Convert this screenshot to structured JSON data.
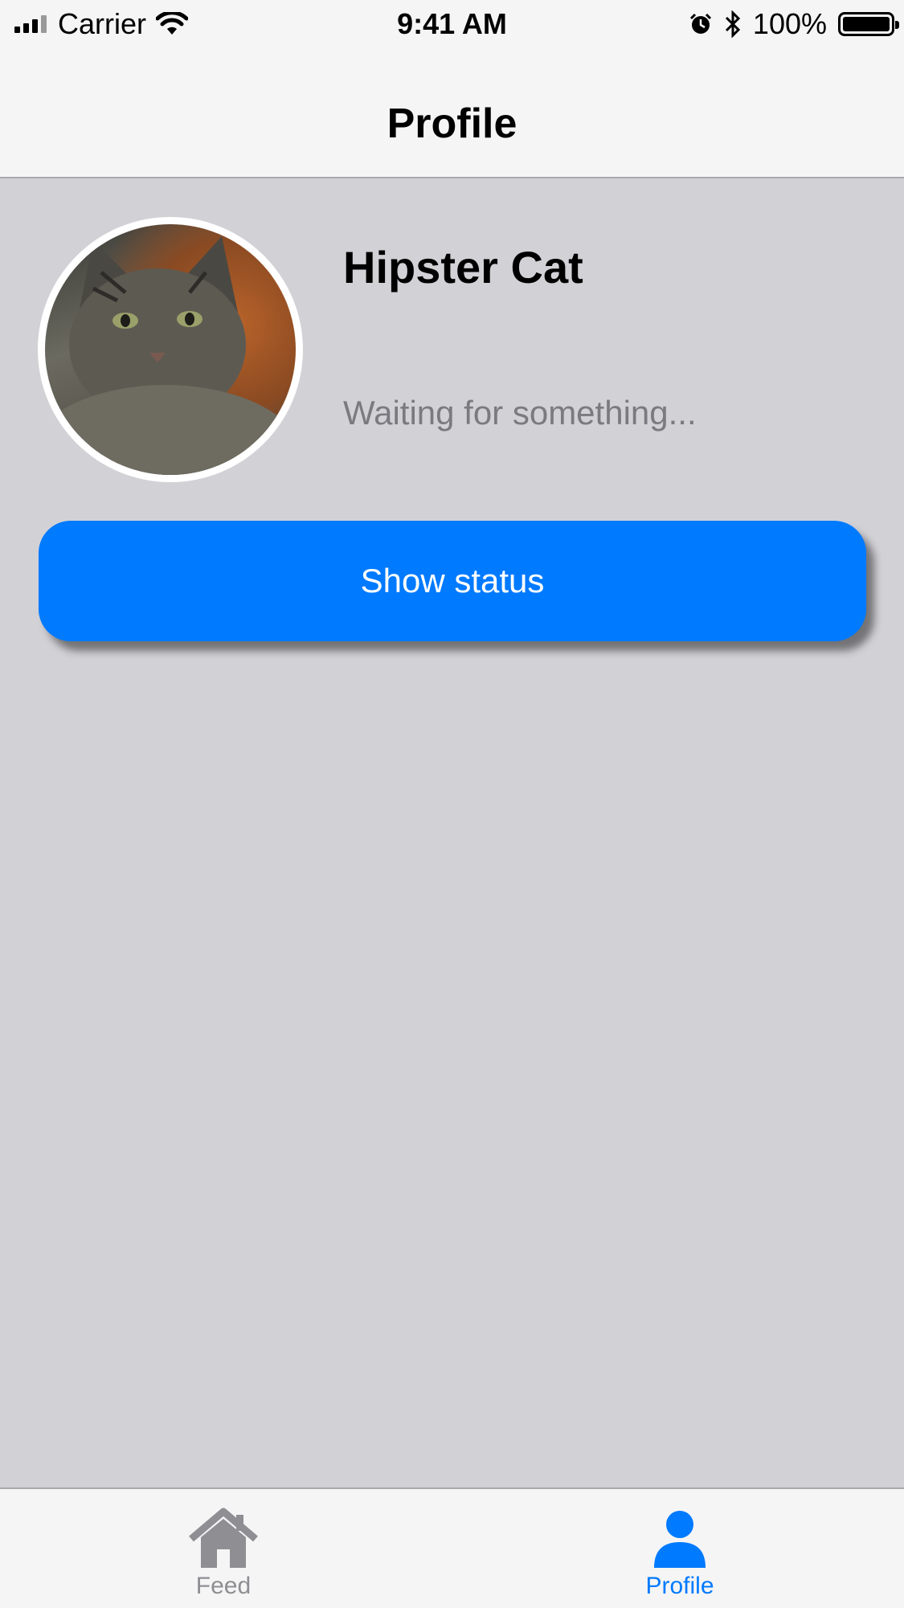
{
  "status_bar": {
    "carrier": "Carrier",
    "time": "9:41 AM",
    "battery": "100%",
    "battery_level": 1.0
  },
  "nav": {
    "title": "Profile"
  },
  "profile": {
    "name": "Hipster Cat",
    "status": "Waiting for something...",
    "avatar_icon": "cat-photo"
  },
  "actions": {
    "show_status_label": "Show status"
  },
  "colors": {
    "accent": "#007aff",
    "background": "#d2d1d6",
    "bar_background": "#f5f5f5",
    "inactive": "#8e8e93",
    "status_text": "#7b7a80"
  },
  "tabs": [
    {
      "label": "Feed",
      "icon": "home-icon",
      "active": false
    },
    {
      "label": "Profile",
      "icon": "person-icon",
      "active": true
    }
  ]
}
